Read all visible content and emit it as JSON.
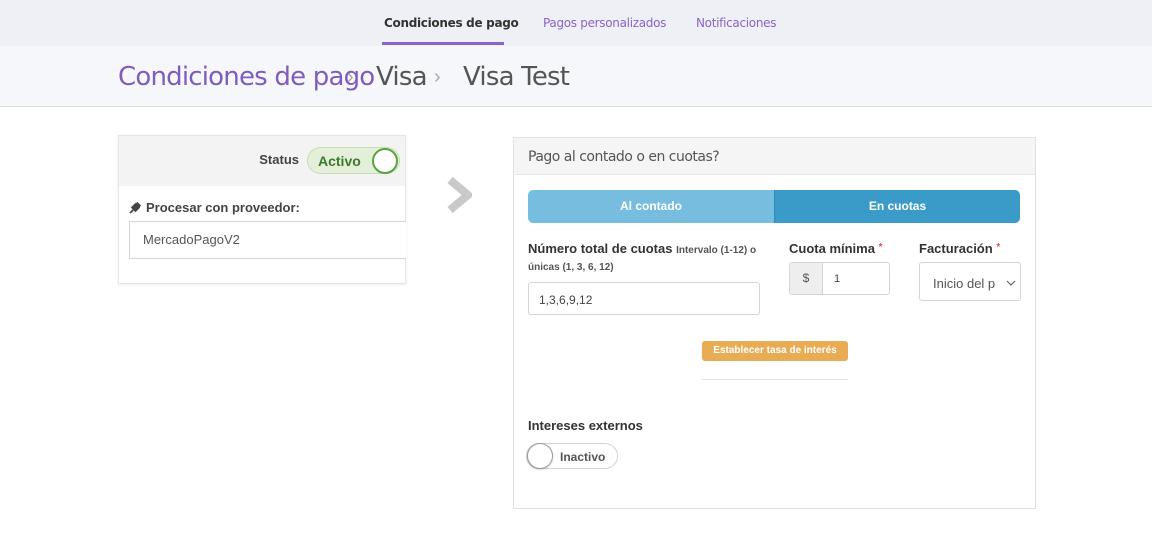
{
  "nav": {
    "tabs": [
      {
        "label": "Condiciones de pago",
        "active": true
      },
      {
        "label": "Pagos personalizados",
        "active": false
      },
      {
        "label": "Notificaciones",
        "active": false
      }
    ]
  },
  "breadcrumb": {
    "items": [
      "Condiciones de pago",
      "Visa",
      "Visa Test"
    ],
    "separator": "›"
  },
  "left_card": {
    "status_label": "Status",
    "status_value": "Activo",
    "provider_label": "Procesar con proveedor:",
    "provider_icon": "plug-icon",
    "provider_value": "MercadoPagoV2"
  },
  "right_card": {
    "title": "Pago al contado o en cuotas?",
    "segment": {
      "option_1": "Al contado",
      "option_2": "En cuotas",
      "selected": "En cuotas"
    },
    "cuotas": {
      "label": "Número total de cuotas",
      "hint_1": "Intervalo (1-12) o",
      "hint_2": "únicas (1, 3, 6, 12)",
      "value": "1,3,6,9,12"
    },
    "cuota_minima": {
      "label": "Cuota mínima",
      "required_mark": "*",
      "currency": "$",
      "value": "1"
    },
    "facturacion": {
      "label": "Facturación",
      "required_mark": "*",
      "value": "Inicio del p"
    },
    "interest_button": "Establecer tasa de interés",
    "external_interest": {
      "label": "Intereses externos",
      "status": "Inactivo"
    }
  },
  "colors": {
    "accent_purple": "#8a63c8",
    "success_green": "#5aa33f",
    "segment_light": "#76bde0",
    "segment_dark": "#3a9bc9",
    "warning_orange": "#e8ac54"
  }
}
